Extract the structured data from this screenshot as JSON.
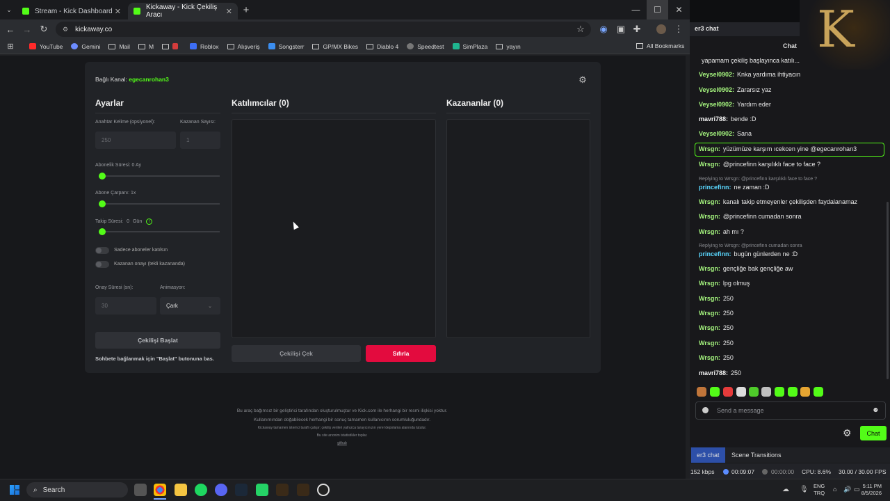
{
  "browser": {
    "tabs": [
      {
        "title": "Stream - Kick Dashboard",
        "active": false
      },
      {
        "title": "Kickaway - Kick Çekiliş Aracı",
        "active": true
      }
    ],
    "new_tab": "+",
    "url": "kickaway.co",
    "bookmarks": [
      "YouTube",
      "Gemini",
      "Mail",
      "M",
      "",
      "Roblox",
      "Alışveriş",
      "Songsterr",
      "GP/MX Bikes",
      "Diablo 4",
      "Speedtest",
      "SimPlaza",
      "yayın"
    ],
    "all_bookmarks": "All Bookmarks"
  },
  "app": {
    "connected_label": "Bağlı Kanal:",
    "connected_channel": "egecanrohan3",
    "settings_title": "Ayarlar",
    "keyword_label": "Anahtar Kelime (opsiyonel):",
    "keyword_value": "250",
    "winner_count_label": "Kazanan Sayısı:",
    "winner_count_value": "1",
    "sub_duration_label": "Abonelik Süresi: 0 Ay",
    "sub_multiplier_label": "Abone Çarpanı: 1x",
    "follow_label": "Takip Süresi:",
    "follow_value": "0",
    "follow_unit": "Gün",
    "only_subs_label": "Sadece aboneler katılsın",
    "winner_confirm_label": "Kazanan onayı (tekli kazananda)",
    "confirm_time_label": "Onay Süresi (sn):",
    "confirm_time_value": "30",
    "animation_label": "Animasyon:",
    "animation_value": "Çark",
    "start_button": "Çekilişi Başlat",
    "hint": "Sohbete bağlanmak için \"Başlat\" butonuna bas.",
    "participants_title": "Katılımcılar (0)",
    "winners_title": "Kazananlar (0)",
    "draw_button": "Çekilişi Çek",
    "reset_button": "Sıfırla",
    "footer": [
      "Bu araç bağımsız bir geliştirici tarafından oluşturulmuştur ve Kick.com ile herhangi bir resmi ilişkisi yoktur.",
      "Kullanımından doğabilecek herhangi bir sonuç tamamen kullanıcının sorumluluğundadır.",
      "Kickaway tamamen istemci taraflı çalışır; çekiliş verileri yalnızca tarayıcınızın yerel depolama alanında tutulur.",
      "Bu site anonim istatistikler toplar.",
      "github"
    ]
  },
  "chat": {
    "header": "er3 chat",
    "title": "Chat",
    "messages": [
      {
        "user": "",
        "text": "yapamam çekiliş başlayınca katılı...",
        "color": "w"
      },
      {
        "user": "Veysel0902:",
        "text": "Knka yardıma ihtiyacın",
        "color": "g"
      },
      {
        "user": "Veysel0902:",
        "text": "Zararsız yaz",
        "color": "g"
      },
      {
        "user": "Veysel0902:",
        "text": "Yardım eder",
        "color": "g"
      },
      {
        "user": "mavri788:",
        "text": "bende :D",
        "color": "w"
      },
      {
        "user": "Veysel0902:",
        "text": "Sana",
        "color": "g"
      },
      {
        "user": "Wrsgn:",
        "text": "yüzümüze karşım ıcekcen yine @egecanrohan3",
        "color": "g",
        "highlight": true
      },
      {
        "user": "Wrsgn:",
        "text": "@princefinn karşılıklı face to face ?",
        "color": "g"
      },
      {
        "reply": "Replying to Wrsgn: @princefinn karşılıklı face to face ?"
      },
      {
        "user": "princefinn:",
        "text": "ne zaman :D",
        "color": "c"
      },
      {
        "user": "Wrsgn:",
        "text": "kanalı takip etmeyenler çekilişden faydalanamaz",
        "color": "g"
      },
      {
        "user": "Wrsgn:",
        "text": "@princefinn cumadan sonra",
        "color": "g"
      },
      {
        "user": "Wrsgn:",
        "text": "ah mı ?",
        "color": "g"
      },
      {
        "reply": "Replying to Wrsgn: @princefinn cumadan sonra"
      },
      {
        "user": "princefinn:",
        "text": "bugün günlerden ne :D",
        "color": "c"
      },
      {
        "user": "Wrsgn:",
        "text": "gençliğe bak gençliğe aw",
        "color": "g"
      },
      {
        "user": "Wrsgn:",
        "text": "lpg olmuş",
        "color": "g"
      },
      {
        "user": "Wrsgn:",
        "text": "250",
        "color": "g"
      },
      {
        "user": "Wrsgn:",
        "text": "250",
        "color": "g"
      },
      {
        "user": "Wrsgn:",
        "text": "250",
        "color": "g"
      },
      {
        "user": "Wrsgn:",
        "text": "250",
        "color": "g"
      },
      {
        "user": "Wrsgn:",
        "text": "250",
        "color": "g"
      },
      {
        "user": "mavri788:",
        "text": "250",
        "color": "w"
      }
    ],
    "placeholder": "Send a message",
    "send_button": "Chat"
  },
  "obs": {
    "tabs": [
      "er3 chat",
      "Scene Transitions"
    ],
    "bitrate": "152 kbps",
    "stream_time": "00:09:07",
    "rec_time": "00:00:00",
    "cpu": "CPU: 8.6%",
    "fps": "30.00 / 30.00 FPS"
  },
  "taskbar": {
    "search": "Search",
    "lang1": "ENG",
    "lang2": "TRQ",
    "time": "5:11 PM",
    "date": "8/5/2026"
  },
  "colors": {
    "accent": "#53fc18",
    "danger": "#e30b3e"
  }
}
